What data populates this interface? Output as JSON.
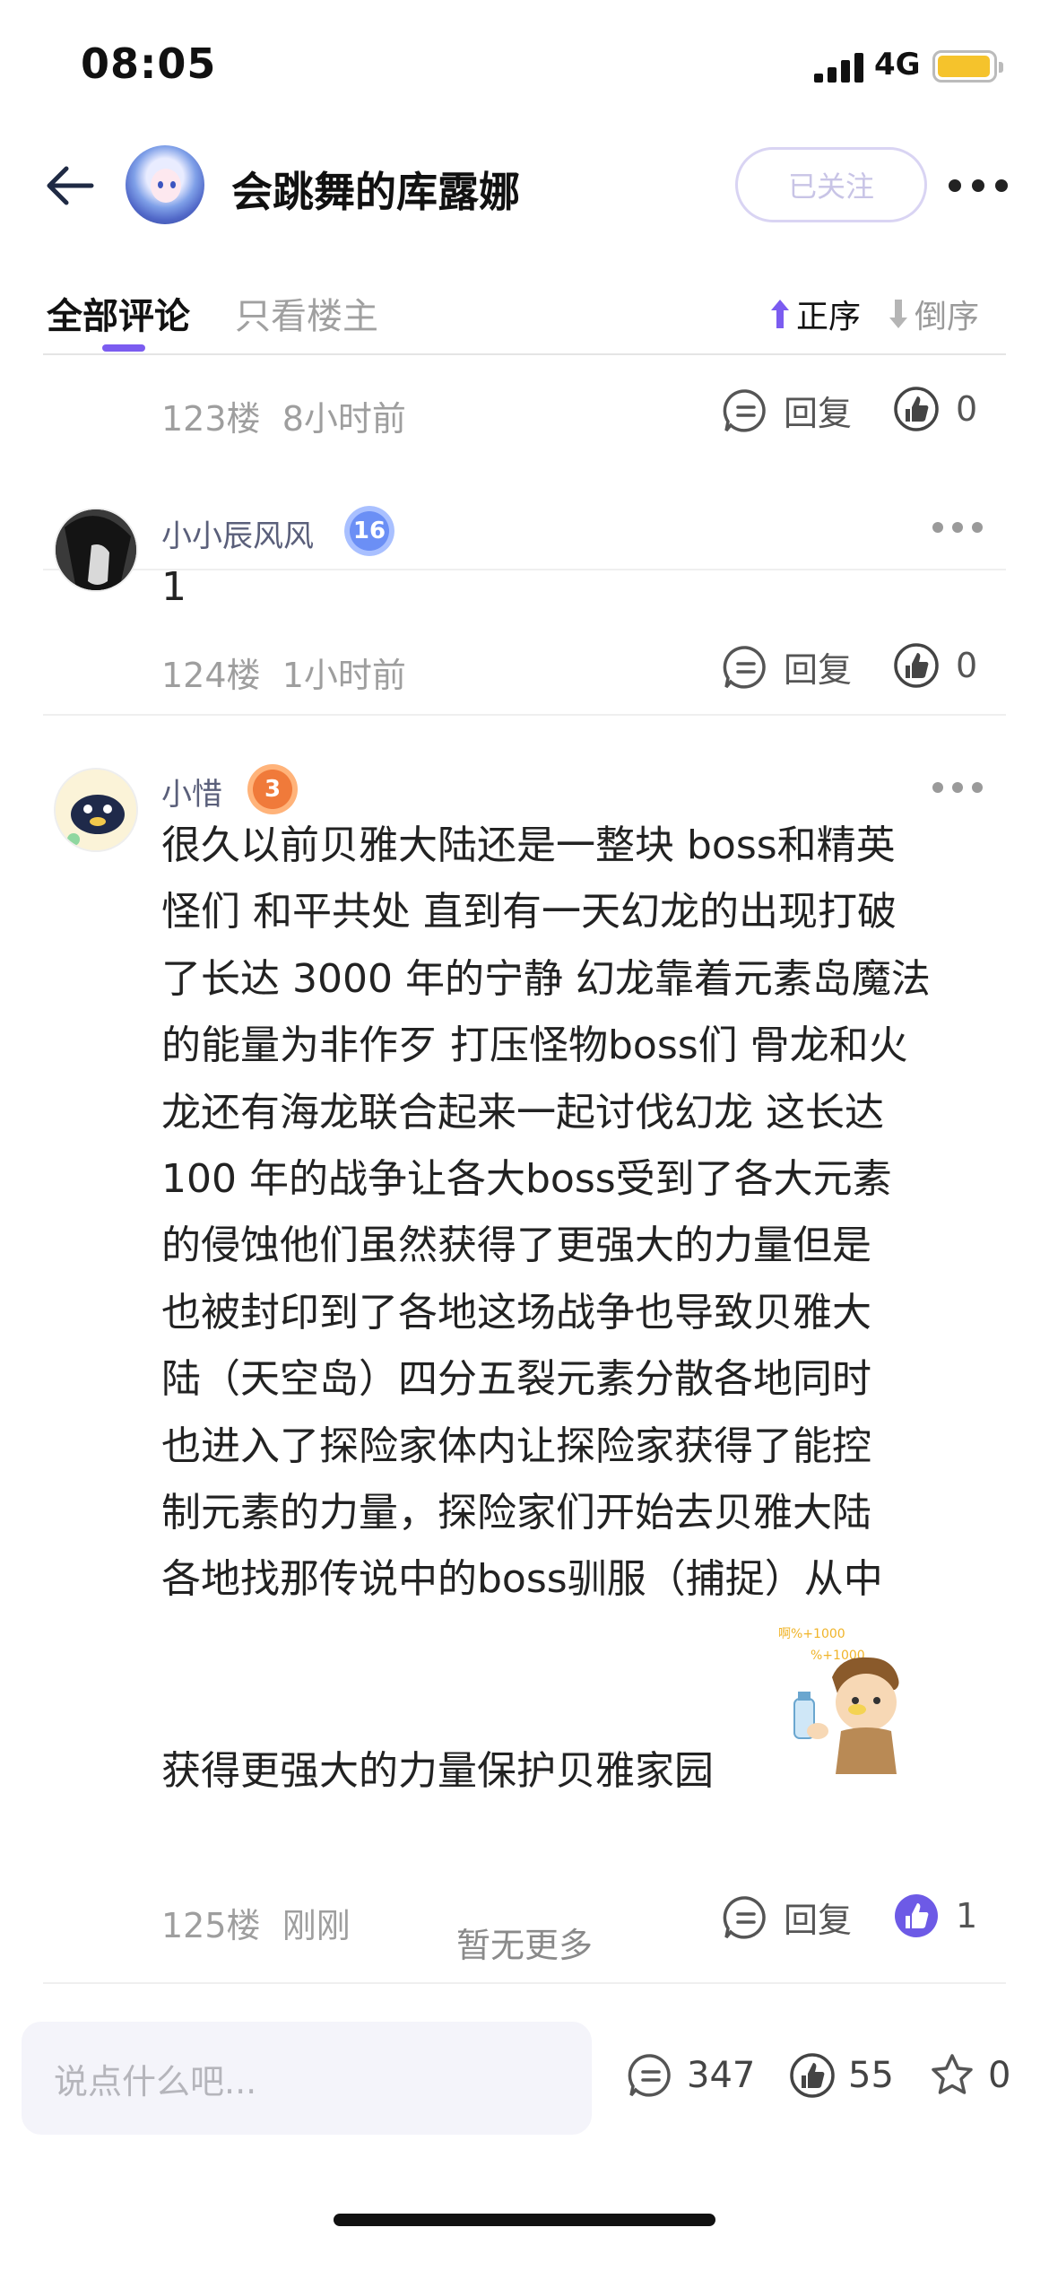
{
  "status_bar": {
    "time": "08:05",
    "network": "4G"
  },
  "header": {
    "title": "会跳舞的库露娜",
    "follow_label": "已关注"
  },
  "tabs": {
    "all": "全部评论",
    "owner_only": "只看楼主"
  },
  "sort": {
    "ascending": "正序",
    "descending": "倒序"
  },
  "comments": [
    {
      "floor": "123楼",
      "time": "8小时前",
      "reply_label": "回复",
      "likes": "0"
    },
    {
      "name": "小小辰风风",
      "level": "16",
      "text": "1",
      "floor": "124楼",
      "time": "1小时前",
      "reply_label": "回复",
      "likes": "0"
    },
    {
      "name": "小惜",
      "level": "3",
      "lines": [
        "很久以前贝雅大陆还是一整块 boss和精英",
        "怪们 和平共处 直到有一天幻龙的出现打破",
        "了长达 3000 年的宁静 幻龙靠着元素岛魔法",
        "的能量为非作歹 打压怪物boss们 骨龙和火",
        "龙还有海龙联合起来一起讨伐幻龙 这长达",
        "100 年的战争让各大boss受到了各大元素",
        "的侵蚀他们虽然获得了更强大的力量但是",
        "也被封印到了各地这场战争也导致贝雅大",
        "陆（天空岛）四分五裂元素分散各地同时",
        "也进入了探险家体内让探险家获得了能控",
        "制元素的力量，探险家们开始去贝雅大陆",
        "各地找那传说中的boss驯服（捕捉）从中"
      ],
      "last_line": "获得更强大的力量保护贝雅家园",
      "sticker_text_1": "啊%+1000",
      "sticker_text_2": "%+1000",
      "floor": "125楼",
      "time": "刚刚",
      "reply_label": "回复",
      "likes": "1"
    }
  ],
  "no_more": "暂无更多",
  "bottom_bar": {
    "input_placeholder": "说点什么吧...",
    "comments_count": "347",
    "likes_count": "55",
    "favorites_count": "0"
  },
  "colors": {
    "accent": "#7b5cf0",
    "muted": "#9e9e9e",
    "follow_border": "#d9d4f3"
  }
}
